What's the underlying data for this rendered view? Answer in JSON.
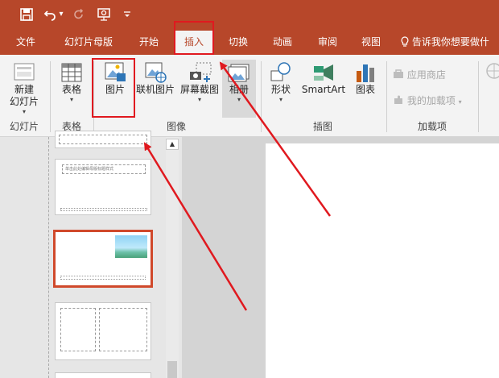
{
  "quick_access": {
    "save_icon": "save-icon",
    "undo_icon": "undo-icon",
    "undo_dropdown": "▾",
    "redo_icon": "redo-icon",
    "start_from_beginning_icon": "present-from-start-icon",
    "customize_icon": "customize-qat-icon"
  },
  "tabs": [
    {
      "label": "文件"
    },
    {
      "label": "幻灯片母版"
    },
    {
      "label": "开始"
    },
    {
      "label": "插入"
    },
    {
      "label": "切换"
    },
    {
      "label": "动画"
    },
    {
      "label": "审阅"
    },
    {
      "label": "视图"
    }
  ],
  "tell_me": "告诉我你想要做什",
  "ribbon": {
    "new_slide": {
      "line1": "新建",
      "line2": "幻灯片"
    },
    "table": "表格",
    "picture": "图片",
    "online_picture": "联机图片",
    "screenshot": "屏幕截图",
    "album": "相册",
    "shapes": "形状",
    "smartart": "SmartArt",
    "chart": "图表",
    "store": "应用商店",
    "my_addins": "我的加载项",
    "groups": {
      "slides": "幻灯片",
      "tables": "表格",
      "images": "图像",
      "illustrations": "插图",
      "addins": "加载项"
    }
  },
  "thumbnails": {
    "slide2_title": "单击此处编辑母版标题样式"
  },
  "colors": {
    "accent": "#b7472a",
    "highlight": "#e0191f"
  }
}
